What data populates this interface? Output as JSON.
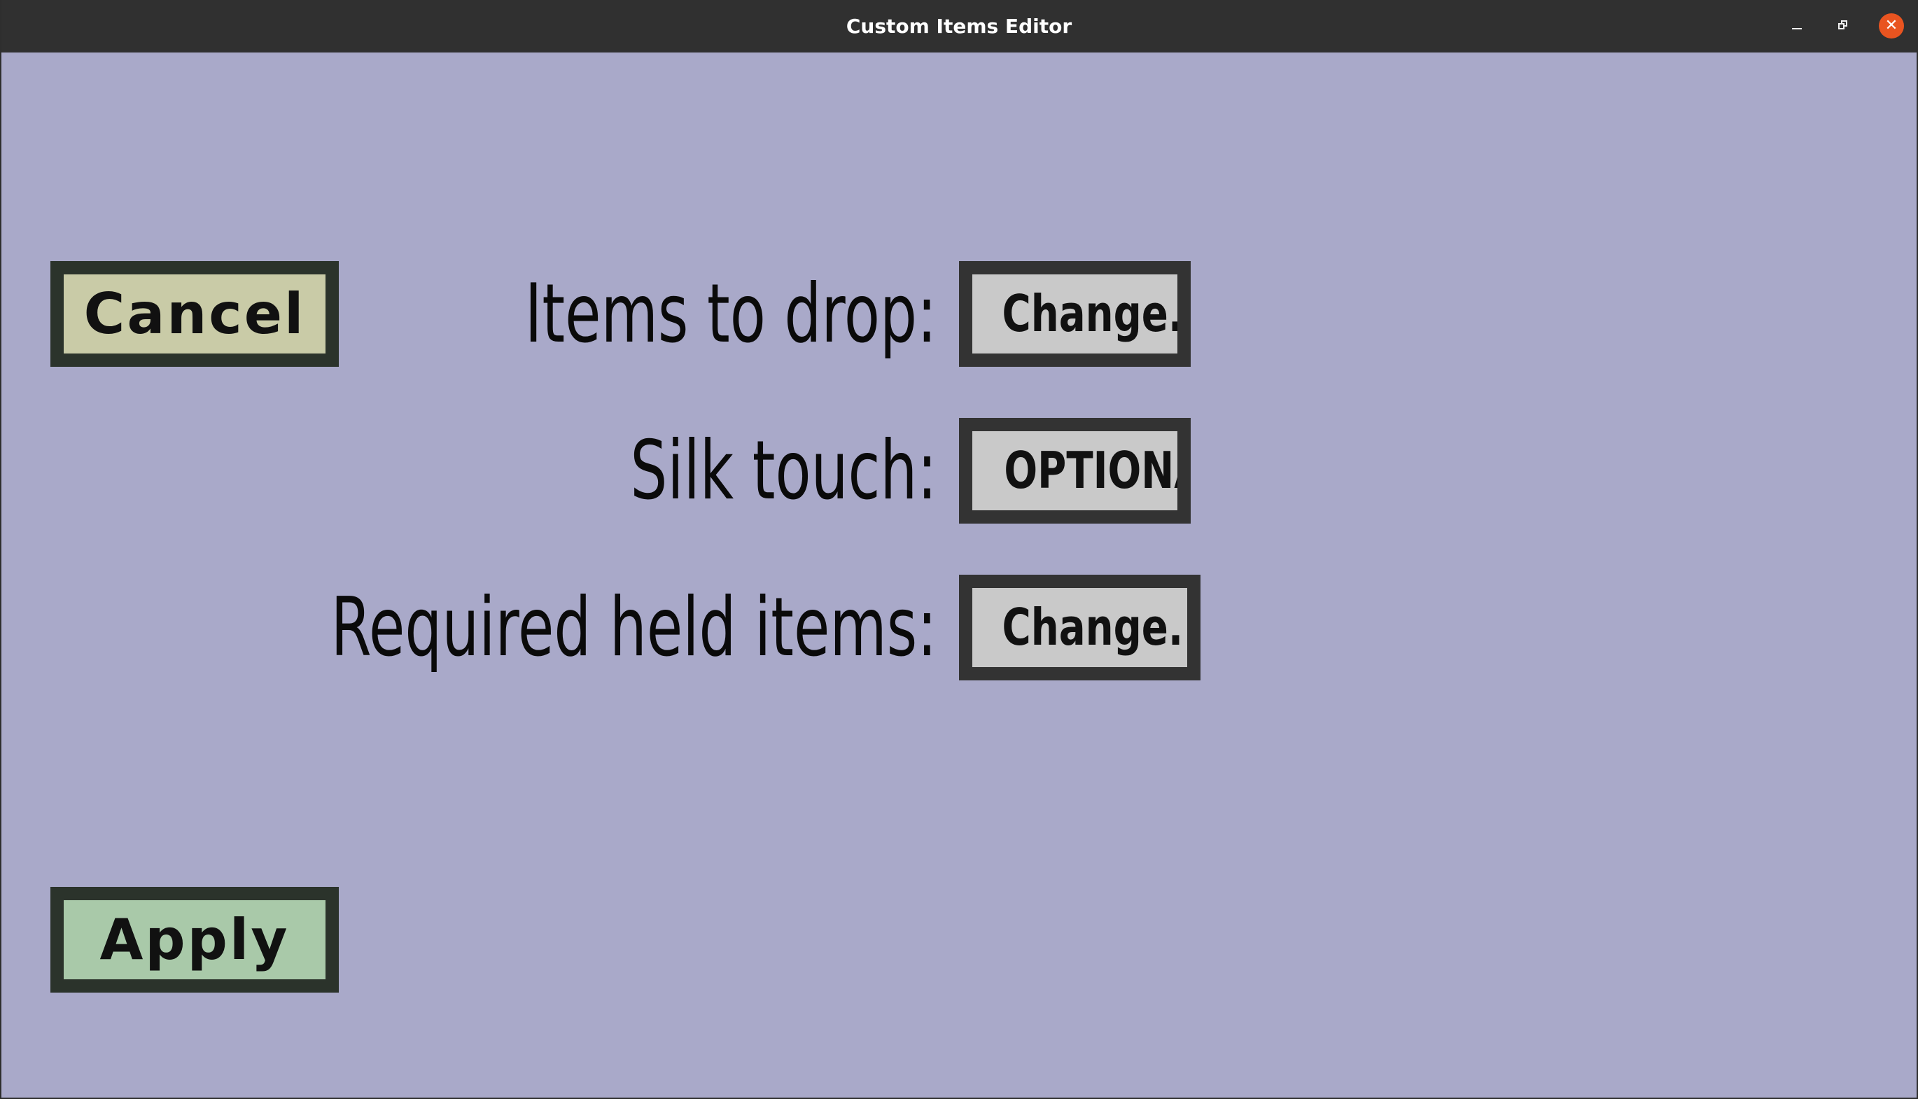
{
  "window": {
    "title": "Custom Items Editor",
    "controls": {
      "minimize": "–",
      "maximize": "❐",
      "close": "✕"
    },
    "background_color": "#a9a9c9"
  },
  "actions": {
    "cancel_label": "Cancel",
    "apply_label": "Apply"
  },
  "fields": [
    {
      "label": "Items to drop:",
      "button_label": "Change..."
    },
    {
      "label": "Silk touch:",
      "button_label": "OPTIONAL"
    },
    {
      "label": "Required held items:",
      "button_label": "Change..."
    }
  ],
  "colors": {
    "cancel_button": "#c9cba7",
    "apply_button": "#a9c9a9",
    "field_button": "#c9c9c9",
    "close_button": "#e95420"
  }
}
